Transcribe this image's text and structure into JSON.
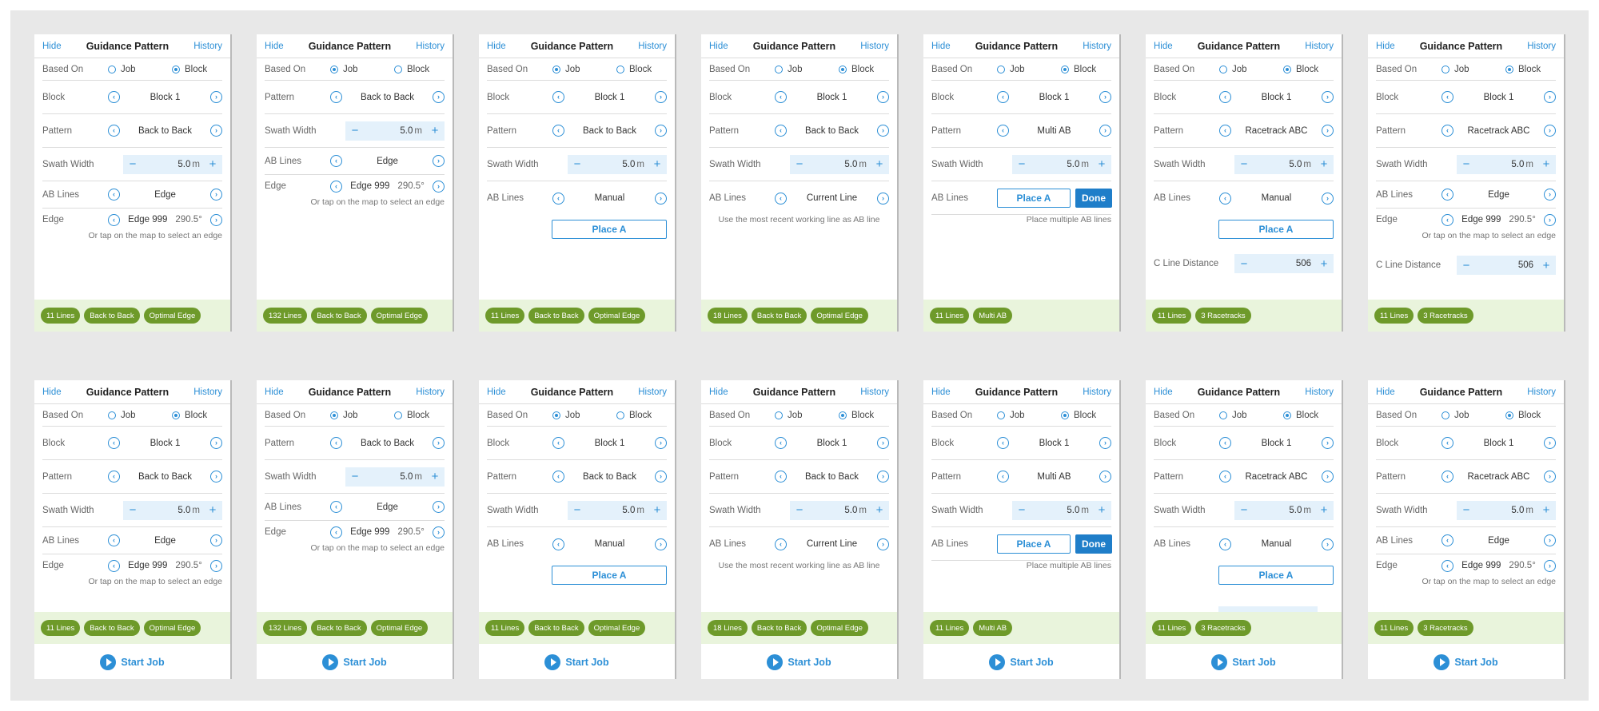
{
  "strings": {
    "hide": "Hide",
    "title": "Guidance Pattern",
    "history": "History",
    "based_on": "Based On",
    "job": "Job",
    "block": "Block",
    "pattern": "Pattern",
    "swath_width": "Swath Width",
    "ab_lines": "AB Lines",
    "edge": "Edge",
    "c_line_distance": "C Line Distance",
    "unit_m": "m",
    "minus": "−",
    "plus": "+",
    "place_a": "Place A",
    "done": "Done",
    "start_job": "Start Job",
    "tap_hint": "Or tap on the map to select an edge",
    "recent_hint": "Use the most recent working line as AB line",
    "multi_hint": "Place multiple AB lines"
  },
  "panels": [
    {
      "based_on": "block",
      "block": "Block 1",
      "pattern": "Back to Back",
      "swath": "5.0",
      "ab": "Edge",
      "edge_name": "Edge 999",
      "edge_deg": "290.5°",
      "chips": [
        "11 Lines",
        "Back to Back",
        "Optimal Edge"
      ]
    },
    {
      "based_on": "job",
      "pattern": "Back to Back",
      "swath": "5.0",
      "ab": "Edge",
      "edge_name": "Edge 999",
      "edge_deg": "290.5°",
      "chips": [
        "132 Lines",
        "Back to Back",
        "Optimal Edge"
      ]
    },
    {
      "based_on": "job",
      "block": "Block 1",
      "pattern": "Back to Back",
      "swath": "5.0",
      "ab": "Manual",
      "chips": [
        "11 Lines",
        "Back to Back",
        "Optimal Edge"
      ]
    },
    {
      "based_on": "block",
      "block": "Block 1",
      "pattern": "Back to Back",
      "swath": "5.0",
      "ab": "Current Line",
      "chips": [
        "18 Lines",
        "Back to Back",
        "Optimal Edge"
      ]
    },
    {
      "based_on": "block",
      "block": "Block 1",
      "pattern": "Multi AB",
      "swath": "5.0",
      "chips": [
        "11 Lines",
        "Multi AB"
      ]
    },
    {
      "based_on": "block",
      "block": "Block 1",
      "pattern": "Racetrack ABC",
      "swath": "5.0",
      "ab": "Manual",
      "c_line": "506",
      "chips": [
        "11 Lines",
        "3 Racetracks"
      ]
    },
    {
      "based_on": "block",
      "block": "Block 1",
      "pattern": "Racetrack ABC",
      "swath": "5.0",
      "ab": "Edge",
      "edge_name": "Edge 999",
      "edge_deg": "290.5°",
      "c_line": "506",
      "chips": [
        "11 Lines",
        "3 Racetracks"
      ]
    }
  ]
}
